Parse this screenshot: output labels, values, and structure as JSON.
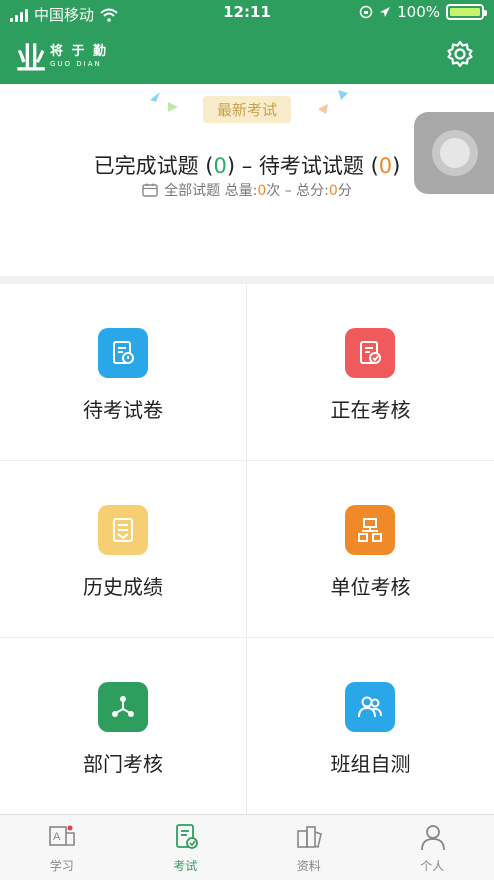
{
  "status_bar": {
    "carrier": "中国移动",
    "time": "12:11",
    "battery": "100%"
  },
  "app": {
    "logo_mark": "业",
    "logo_cn": "将 于 勤",
    "logo_en": "GUO DIAN"
  },
  "hero": {
    "flag": "最新考试",
    "completed_label": "已完成试题",
    "completed_count": "0",
    "dash": "–",
    "pending_label": "待考试试题",
    "pending_count": "0",
    "all_label": "全部试题",
    "total_label": "总量:",
    "total_count": "0",
    "total_unit": "次",
    "score_sep": "–",
    "score_label": "总分:",
    "score_value": "0",
    "score_unit": "分"
  },
  "grid": [
    {
      "label": "待考试卷",
      "color": "#2aa7e8"
    },
    {
      "label": "正在考核",
      "color": "#ef5b5b"
    },
    {
      "label": "历史成绩",
      "color": "#f7cf73"
    },
    {
      "label": "单位考核",
      "color": "#f08a28"
    },
    {
      "label": "部门考核",
      "color": "#2e9e5e"
    },
    {
      "label": "班组自测",
      "color": "#2aa7e8"
    }
  ],
  "tabs": [
    {
      "label": "学习",
      "icon": "study-icon"
    },
    {
      "label": "考试",
      "icon": "exam-icon"
    },
    {
      "label": "资料",
      "icon": "materials-icon"
    },
    {
      "label": "个人",
      "icon": "profile-icon"
    }
  ],
  "colors": {
    "brand": "#2e9e5e",
    "accent_orange": "#f08a28",
    "count_green": "#2ea865"
  }
}
